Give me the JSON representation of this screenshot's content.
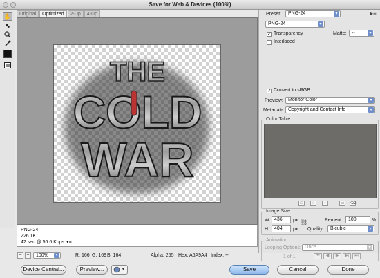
{
  "window": {
    "title": "Save for Web & Devices (100%)"
  },
  "tabs": [
    {
      "label": "Original",
      "active": false
    },
    {
      "label": "Optimized",
      "active": true
    },
    {
      "label": "2-Up",
      "active": false
    },
    {
      "label": "4-Up",
      "active": false
    }
  ],
  "tools": [
    {
      "name": "hand-tool-icon",
      "glyph": "✋"
    },
    {
      "name": "slice-select-tool-icon",
      "glyph": "⬉"
    },
    {
      "name": "zoom-tool-icon",
      "glyph": "🔍"
    },
    {
      "name": "eyedropper-tool-icon",
      "glyph": "⟋"
    }
  ],
  "artwork": {
    "line1": "THE",
    "line2": "COLD",
    "line3": "WAR"
  },
  "info": {
    "format": "PNG-24",
    "size": "226.1K",
    "time": "42 sec @ 56.6 Kbps",
    "menu": "▾≡"
  },
  "status": {
    "zoom": "100%",
    "r": "R: 166",
    "g": "G: 169",
    "b": "B: 164",
    "alpha": "Alpha: 255",
    "hex": "Hex: A6A9A4",
    "index": "Index: --"
  },
  "buttons": {
    "device_central": "Device Central...",
    "preview": "Preview...",
    "save": "Save",
    "cancel": "Cancel",
    "done": "Done"
  },
  "panel": {
    "preset_label": "Preset:",
    "preset_value": "PNG-24",
    "format_value": "PNG-24",
    "transparency": "Transparency",
    "transparency_checked": true,
    "matte_label": "Matte:",
    "matte_value": "--",
    "interlaced": "Interlaced",
    "interlaced_checked": false,
    "convert_srgb": "Convert to sRGB",
    "convert_checked": true,
    "preview_label": "Preview:",
    "preview_value": "Monitor Color",
    "metadata_label": "Metadata:",
    "metadata_value": "Copyright and Contact Info",
    "color_table_label": "Color Table",
    "image_size_label": "Image Size",
    "w_label": "W:",
    "w_value": "436",
    "h_label": "H:",
    "h_value": "404",
    "px": "px",
    "percent_label": "Percent:",
    "percent_value": "100",
    "percent_unit": "%",
    "quality_label": "Quality:",
    "quality_value": "Bicubic",
    "animation_label": "Animation",
    "looping_label": "Looping Options:",
    "looping_value": "Once",
    "frame_counter": "1 of 1"
  },
  "colors": {
    "canvas_bg": "#9c9c9c",
    "accent": "#6e8fc9",
    "color_table_bg": "#6e6c68"
  }
}
